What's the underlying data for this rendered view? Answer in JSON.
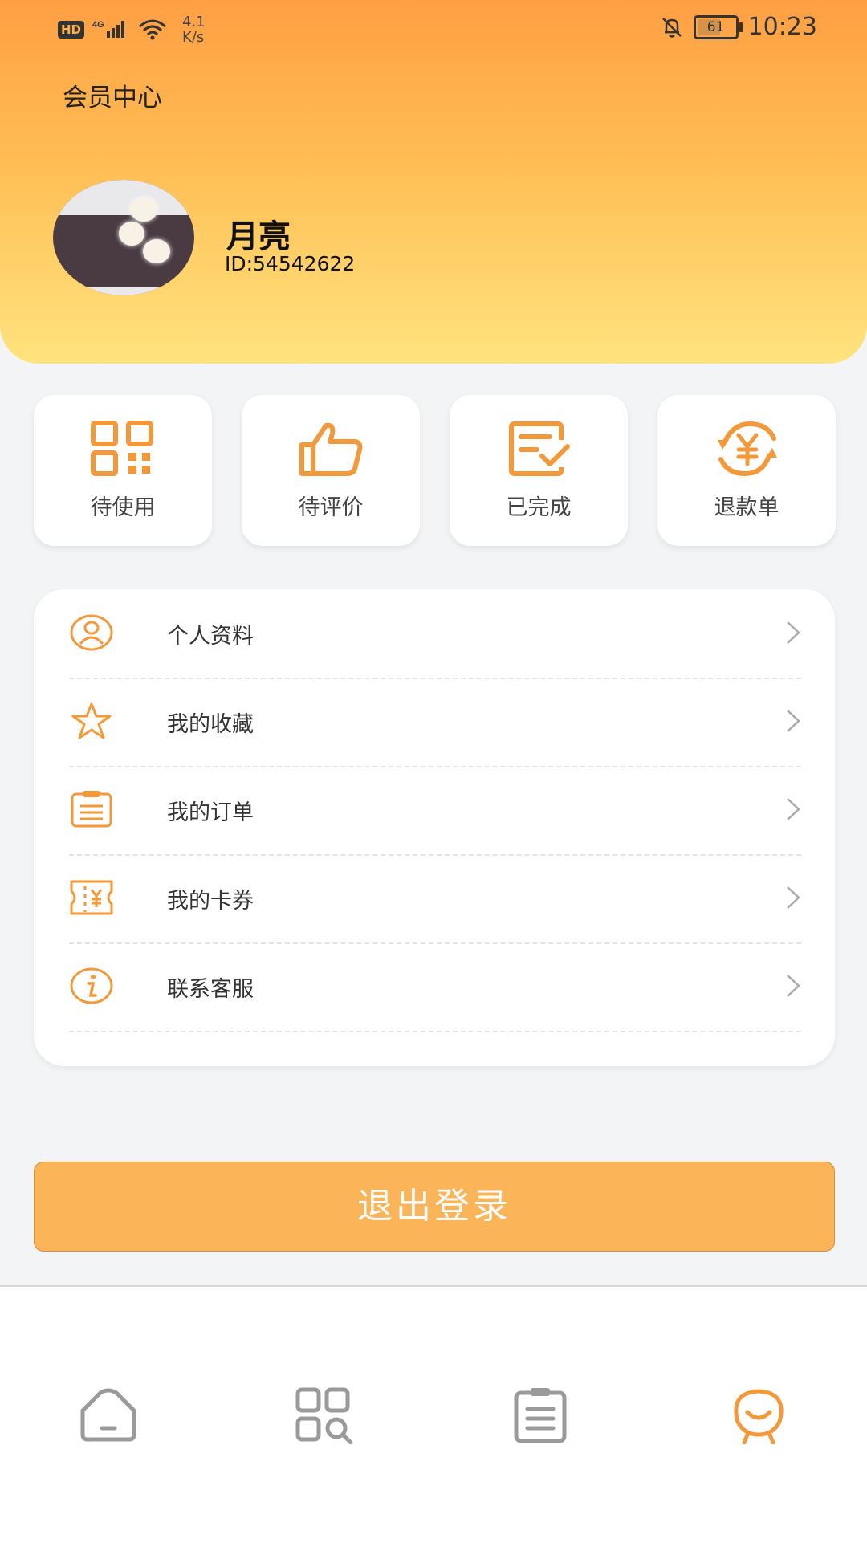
{
  "status_bar": {
    "hd": "HD",
    "net_speed_value": "4.1",
    "net_speed_unit": "K/s",
    "battery": "61",
    "time": "10:23"
  },
  "header": {
    "title": "会员中心"
  },
  "user": {
    "name": "月亮",
    "id": "ID:54542622"
  },
  "quick_actions": [
    {
      "label": "待使用",
      "icon": "qr-code-icon"
    },
    {
      "label": "待评价",
      "icon": "thumbs-up-icon"
    },
    {
      "label": "已完成",
      "icon": "document-check-icon"
    },
    {
      "label": "退款单",
      "icon": "refund-yen-icon"
    }
  ],
  "menu": [
    {
      "label": "个人资料",
      "icon": "user-circle-icon"
    },
    {
      "label": "我的收藏",
      "icon": "star-icon"
    },
    {
      "label": "我的订单",
      "icon": "order-clipboard-icon"
    },
    {
      "label": "我的卡券",
      "icon": "coupon-ticket-icon"
    },
    {
      "label": "联系客服",
      "icon": "info-circle-icon"
    }
  ],
  "logout_label": "退出登录",
  "colors": {
    "accent": "#f4993a",
    "header_top": "#ff9f43",
    "header_bottom": "#ffe37e",
    "logout_bg": "#fcb459",
    "tab_inactive": "#9a9a9a"
  },
  "tabbar": [
    {
      "icon": "home-icon",
      "active": false
    },
    {
      "icon": "category-search-icon",
      "active": false
    },
    {
      "icon": "orders-icon",
      "active": false
    },
    {
      "icon": "profile-smile-icon",
      "active": true
    }
  ]
}
